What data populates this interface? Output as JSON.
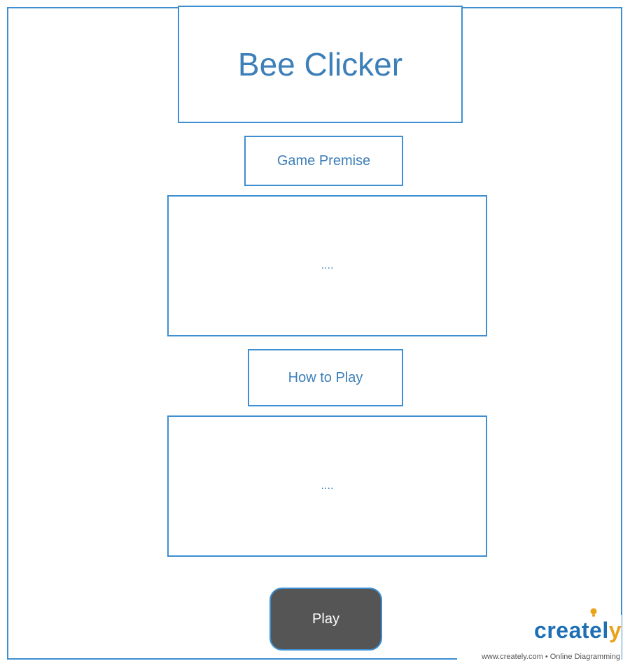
{
  "title": "Bee Clicker",
  "sections": {
    "premise_label": "Game Premise",
    "premise_content": "....",
    "howto_label": "How to Play",
    "howto_content": "...."
  },
  "play_button": "Play",
  "watermark": {
    "logo_main": "createl",
    "logo_accent": "y",
    "tagline": "www.creately.com • Online Diagramming"
  },
  "colors": {
    "border": "#3d8fd1",
    "text": "#3d7fb8",
    "button_bg": "#555555",
    "button_text": "#ffffff",
    "logo_blue": "#1f6fb5",
    "logo_orange": "#e8a31b"
  }
}
